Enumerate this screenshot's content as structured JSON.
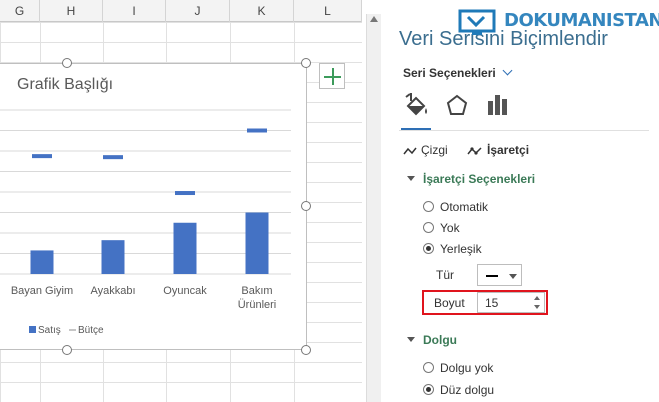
{
  "sheet": {
    "columns": [
      "G",
      "H",
      "I",
      "J",
      "K",
      "L"
    ]
  },
  "chart_data": {
    "type": "bar",
    "title": "Grafik Başlığı",
    "categories": [
      "Bayan Giyim",
      "Ayakkabı",
      "Oyuncak",
      "Bakım Ürünleri"
    ],
    "category_lines": [
      [
        "Bayan Giyim"
      ],
      [
        "Ayakkabı"
      ],
      [
        "Oyuncak"
      ],
      [
        "Bakım",
        "Ürünleri"
      ]
    ],
    "series": [
      {
        "name": "Satış",
        "type": "bar",
        "color": "#4472c4",
        "values": [
          23,
          33,
          50,
          60
        ]
      },
      {
        "name": "Bütçe",
        "type": "marker-dash",
        "color": "#4472c4",
        "values": [
          115,
          114,
          79,
          140
        ]
      }
    ],
    "ylim": [
      0,
      160
    ],
    "grid": true,
    "legend": "bottom"
  },
  "pane": {
    "title": "Veri Serisini Biçimlendir",
    "watermark": "DOKUMANISTAN",
    "series_options_label": "Seri Seçenekleri",
    "tabs": {
      "line": "Çizgi",
      "marker": "İşaretçi"
    },
    "marker_section": {
      "title": "İşaretçi Seçenekleri",
      "options": [
        "Otomatik",
        "Yok",
        "Yerleşik"
      ],
      "selected": "Yerleşik",
      "type_label": "Tür",
      "size_label": "Boyut",
      "size_value": "15"
    },
    "fill_section": {
      "title": "Dolgu",
      "options": [
        "Dolgu yok",
        "Düz dolgu"
      ],
      "selected": "Düz dolgu"
    }
  }
}
